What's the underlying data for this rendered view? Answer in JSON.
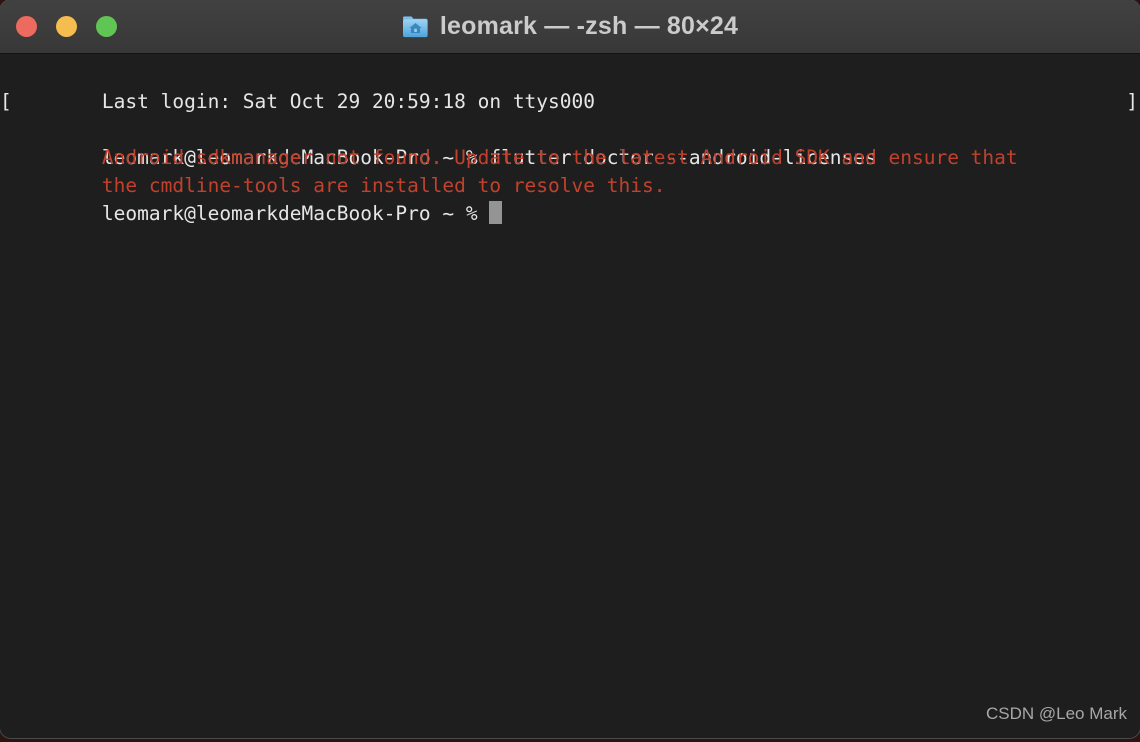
{
  "window": {
    "title": "leomark — -zsh — 80×24",
    "icon": "folder-home-icon",
    "colors": {
      "titlebar_bg": "#3c3c3c",
      "terminal_bg": "#1e1e1e",
      "text": "#e6e6e6",
      "error_text": "#c1412d",
      "cursor": "#949494",
      "close": "#ec6a5e",
      "minimize": "#f5bd4f",
      "zoom": "#61c555"
    },
    "controls": {
      "close_label": "close",
      "minimize_label": "minimize",
      "zoom_label": "zoom"
    }
  },
  "terminal": {
    "columns": 80,
    "rows": 24,
    "lines": [
      {
        "text": "Last login: Sat Oct 29 20:59:18 on ttys000",
        "type": "output",
        "mark_left": "",
        "mark_right": ""
      },
      {
        "text": "leomark@leomarkdeMacBook-Pro ~ % flutter doctor --android-licenses",
        "type": "prompt",
        "mark_left": "[",
        "mark_right": "]"
      },
      {
        "text": "Android sdkmanager not found. Update to the latest Android SDK and ensure that",
        "type": "error",
        "mark_left": "",
        "mark_right": ""
      },
      {
        "text": "the cmdline-tools are installed to resolve this.",
        "type": "error",
        "mark_left": "",
        "mark_right": ""
      },
      {
        "text": "leomark@leomarkdeMacBook-Pro ~ % ",
        "type": "prompt-active",
        "mark_left": "",
        "mark_right": ""
      }
    ]
  },
  "watermark": {
    "text": "CSDN @Leo Mark"
  }
}
